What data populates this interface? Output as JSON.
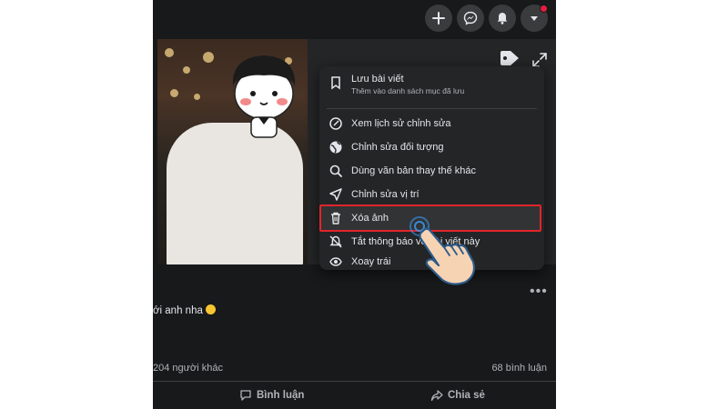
{
  "header": {
    "buttons": [
      {
        "icon": "plus-icon"
      },
      {
        "icon": "messenger-icon"
      },
      {
        "icon": "bell-icon"
      },
      {
        "icon": "chevron-down-icon"
      }
    ]
  },
  "photo_toolbar": {
    "tag_icon": "tag-icon",
    "expand_icon": "expand-icon"
  },
  "menu": {
    "items": [
      {
        "label": "Lưu bài viết",
        "sublabel": "Thêm vào danh sách mục đã lưu",
        "icon": "bookmark-icon"
      },
      {
        "label": "Xem lịch sử chỉnh sửa",
        "icon": "history-icon"
      },
      {
        "label": "Chỉnh sửa đối tượng",
        "icon": "globe-icon"
      },
      {
        "label": "Dùng văn bản thay thế khác",
        "icon": "search-icon"
      },
      {
        "label": "Chỉnh sửa vị trí",
        "icon": "location-arrow-icon"
      },
      {
        "label": "Xóa ảnh",
        "icon": "trash-icon"
      },
      {
        "label": "Tắt thông báo về bài viết này",
        "icon": "bell-off-icon"
      },
      {
        "label": "Xoay trái",
        "icon": "rotate-icon"
      }
    ],
    "highlighted_item": "Xóa ảnh"
  },
  "post": {
    "caption": "ới anh nha",
    "reactions_text": "204 người khác",
    "comments_text": "68 bình luận",
    "actions": {
      "comment": "Bình luận",
      "share": "Chia sẻ"
    }
  },
  "colors": {
    "background": "#18191a",
    "menu": "#242526",
    "highlight_border": "#e1252b",
    "text": "#e4e6eb"
  }
}
